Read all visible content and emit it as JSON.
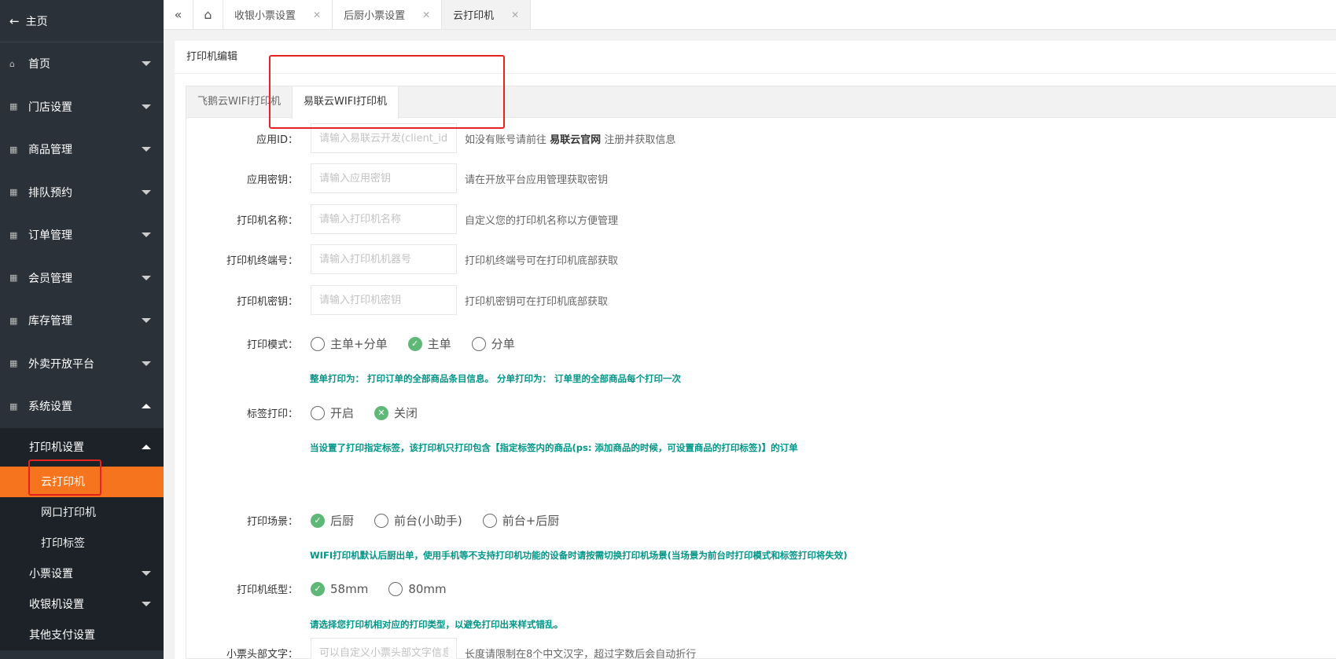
{
  "sidebar": {
    "home": "主页",
    "items": [
      {
        "label": "首页",
        "icon": "home-icon"
      },
      {
        "label": "门店设置"
      },
      {
        "label": "商品管理"
      },
      {
        "label": "排队预约"
      },
      {
        "label": "订单管理"
      },
      {
        "label": "会员管理"
      },
      {
        "label": "库存管理"
      },
      {
        "label": "外卖开放平台"
      },
      {
        "label": "系统设置"
      }
    ],
    "printer_settings": "打印机设置",
    "sub": {
      "cloud": "云打印机",
      "network": "网口打印机",
      "label": "打印标签"
    },
    "ticket_settings": "小票设置",
    "cashier_settings": "收银机设置",
    "other_payment": "其他支付设置"
  },
  "topbar": {
    "tabs": [
      "收银小票设置",
      "后厨小票设置",
      "云打印机"
    ],
    "active": "云打印机"
  },
  "panel": {
    "title": "打印机编辑",
    "tabs": [
      "飞鹅云WIFI打印机",
      "易联云WIFI打印机"
    ]
  },
  "form": {
    "app_id": {
      "label": "应用ID：",
      "placeholder": "请输入易联云开发(client_id)号",
      "hint_pre": "如没有账号请前往",
      "hint_link": "易联云官网",
      "hint_post": "注册并获取信息"
    },
    "app_secret": {
      "label": "应用密钥：",
      "placeholder": "请输入应用密钥",
      "hint": "请在开放平台应用管理获取密钥"
    },
    "printer_name": {
      "label": "打印机名称：",
      "placeholder": "请输入打印机名称",
      "hint": "自定义您的打印机名称以方便管理"
    },
    "terminal_no": {
      "label": "打印机终端号：",
      "placeholder": "请输入打印机机器号",
      "hint": "打印机终端号可在打印机底部获取"
    },
    "printer_key": {
      "label": "打印机密钥：",
      "placeholder": "请输入打印机密钥",
      "hint": "打印机密钥可在打印机底部获取"
    },
    "print_mode": {
      "label": "打印模式：",
      "options": [
        "主单+分单",
        "主单",
        "分单"
      ],
      "selected": "主单",
      "note": "整单打印为：  打印订单的全部商品条目信息。  分单打印为：  订单里的全部商品每个打印一次"
    },
    "label_print": {
      "label": "标签打印：",
      "options": [
        "开启",
        "关闭"
      ],
      "selected": "关闭",
      "note": "当设置了打印指定标签，该打印机只打印包含【指定标签内的商品(ps: 添加商品的时候，可设置商品的打印标签)】的订单"
    },
    "scene": {
      "label": "打印场景：",
      "options": [
        "后厨",
        "前台(小助手)",
        "前台+后厨"
      ],
      "selected": "后厨",
      "note": "WIFI打印机默认后厨出单，使用手机等不支持打印机功能的设备时请按需切换打印机场景(当场景为前台时打印模式和标签打印将失效)"
    },
    "paper": {
      "label": "打印机纸型：",
      "options": [
        "58mm",
        "80mm"
      ],
      "selected": "58mm",
      "note": "请选择您打印机相对应的打印类型，以避免打印出来样式错乱。"
    },
    "header_text": {
      "label": "小票头部文字：",
      "placeholder": "可以自定义小票头部文字信息",
      "hint": "长度请限制在8个中文汉字，超过字数后会自动折行"
    }
  }
}
